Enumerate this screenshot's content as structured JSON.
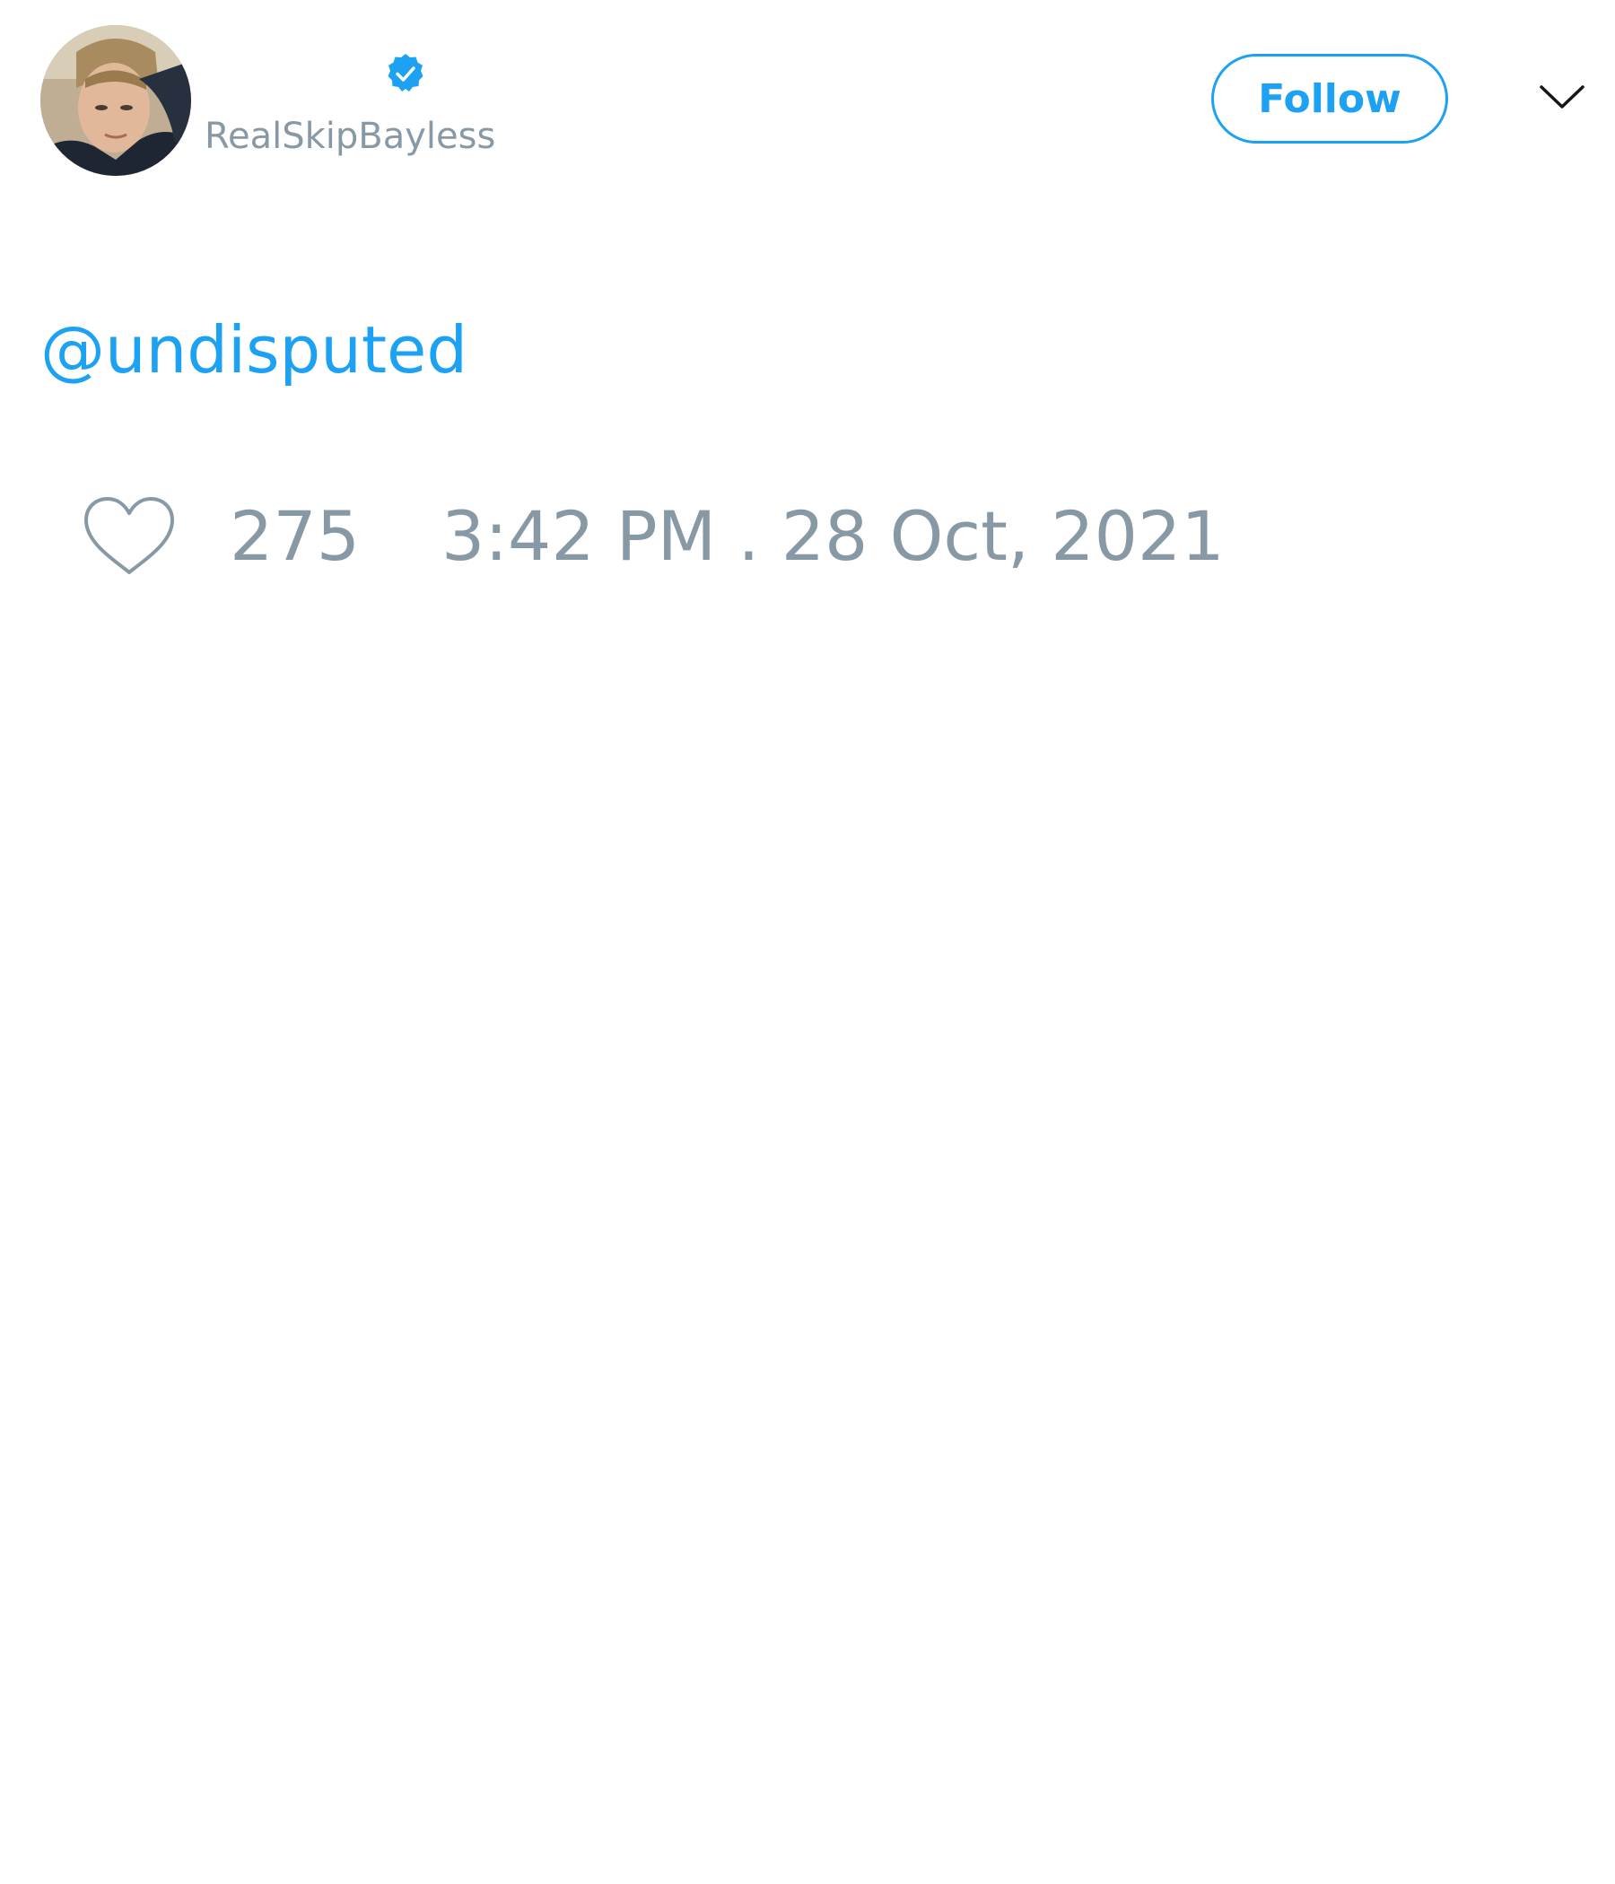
{
  "author": {
    "handle": "RealSkipBayless",
    "verified": true,
    "avatar_icon": "avatar-photo"
  },
  "header": {
    "follow_label": "Follow",
    "menu_icon": "chevron-down-icon"
  },
  "tweet": {
    "text": "@undisputed"
  },
  "footer": {
    "like_icon": "heart-icon",
    "like_count": "275",
    "timestamp": "3:42 PM . 28 Oct, 2021"
  },
  "colors": {
    "accent": "#1da1f2",
    "muted_text": "#8899a6",
    "background": "#ffffff"
  }
}
